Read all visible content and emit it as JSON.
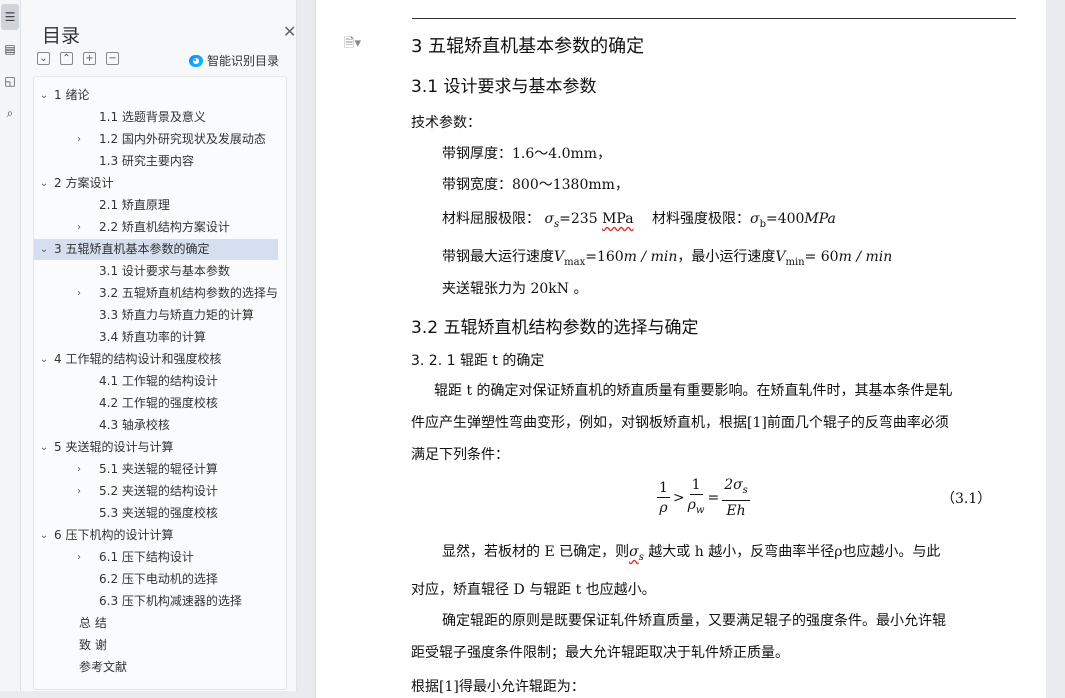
{
  "toc": {
    "title": "目录",
    "smart_recognize": "智能识别目录",
    "items": [
      {
        "label": "1  绪论",
        "level": 0,
        "arrow": "v"
      },
      {
        "label": "1.1  选题背景及意义",
        "level": 2,
        "arrow": ""
      },
      {
        "label": "1.2  国内外研究现状及发展动态",
        "level": 2,
        "arrow": ">"
      },
      {
        "label": "1.3  研究主要内容",
        "level": 2,
        "arrow": ""
      },
      {
        "label": "2  方案设计",
        "level": 0,
        "arrow": "v"
      },
      {
        "label": "2.1  矫直原理",
        "level": 2,
        "arrow": ""
      },
      {
        "label": "2.2  矫直机结构方案设计",
        "level": 2,
        "arrow": ">"
      },
      {
        "label": "3  五辊矫直机基本参数的确定",
        "level": 0,
        "arrow": "v",
        "selected": true
      },
      {
        "label": "3.1  设计要求与基本参数",
        "level": 2,
        "arrow": ""
      },
      {
        "label": "3.2  五辊矫直机结构参数的选择与…",
        "level": 2,
        "arrow": ">"
      },
      {
        "label": "3.3 矫直力与矫直力矩的计算",
        "level": 2,
        "arrow": ""
      },
      {
        "label": "3.4  矫直功率的计算",
        "level": 2,
        "arrow": ""
      },
      {
        "label": "4  工作辊的结构设计和强度校核",
        "level": 0,
        "arrow": "v"
      },
      {
        "label": "4.1 工作辊的结构设计",
        "level": 2,
        "arrow": ""
      },
      {
        "label": "4.2 工作辊的强度校核",
        "level": 2,
        "arrow": ""
      },
      {
        "label": "4.3 轴承校核",
        "level": 2,
        "arrow": ""
      },
      {
        "label": "5  夹送辊的设计与计算",
        "level": 0,
        "arrow": "v"
      },
      {
        "label": "5.1  夹送辊的辊径计算",
        "level": 2,
        "arrow": ">"
      },
      {
        "label": "5.2  夹送辊的结构设计",
        "level": 2,
        "arrow": ">"
      },
      {
        "label": "5.3  夹送辊的强度校核",
        "level": 2,
        "arrow": ""
      },
      {
        "label": "6  压下机构的设计计算",
        "level": 0,
        "arrow": "v"
      },
      {
        "label": "6.1 压下结构设计",
        "level": 2,
        "arrow": ">"
      },
      {
        "label": "6.2 压下电动机的选择",
        "level": 2,
        "arrow": ""
      },
      {
        "label": "6.3 压下机构减速器的选择",
        "level": 2,
        "arrow": ""
      },
      {
        "label": "总    结",
        "level": 1,
        "arrow": ""
      },
      {
        "label": "致    谢",
        "level": 1,
        "arrow": ""
      },
      {
        "label": "参考文献",
        "level": 1,
        "arrow": ""
      }
    ]
  },
  "doc": {
    "h1": "3  五辊矫直机基本参数的确定",
    "h2_1": "3.1  设计要求与基本参数",
    "tech_params": "技术参数：",
    "thickness": "带钢厚度：1.6～4.0mm，",
    "width": "带钢宽度：800～1380mm，",
    "yield_label": "材料屈服极限：",
    "yield_sym": "σ",
    "yield_sub": "s",
    "yield_val": "=235",
    "yield_unit": "MPa",
    "strength_label": "材料强度极限：",
    "strength_sym": "σ",
    "strength_sub": "b",
    "strength_val": "=400",
    "strength_unit": "MPa",
    "vmax_label": "带钢最大运行速度",
    "vmax_sym": "V",
    "vmax_sub": "max",
    "vmax_val": "=160",
    "vmax_unit": "m / min",
    "vmin_label": "，最小运行速度",
    "vmin_sym": "V",
    "vmin_sub": "min",
    "vmin_val": "= 60",
    "vmin_unit": "m / min",
    "tension": "夹送辊张力为 20kN  。",
    "h2_2": "3.2  五辊矫直机结构参数的选择与确定",
    "h3": "3. 2. 1  辊距 t 的确定",
    "p1": "辊距 t 的确定对保证矫直机的矫直质量有重要影响。在矫直轧件时，其基本条件是轧",
    "p2": "件应产生弹塑性弯曲变形，例如，对钢板矫直机，根据[1]前面几个辊子的反弯曲率必须",
    "p3": "满足下列条件：",
    "eq_one": "1",
    "eq_rho": "ρ",
    "eq_gt": ">",
    "eq_rhow": "ρ",
    "eq_w": "w",
    "eq_eq": "=",
    "eq_2sigma": "2σ",
    "eq_s": "s",
    "eq_Eh": "Eh",
    "eq_no": "（3.1）",
    "p4_a": "显然，若板材的 E 已确定，则",
    "p4_sigma": "σ",
    "p4_s": "s",
    "p4_b": " 越大或 h 越小，反弯曲率半径ρ也应越小。与此",
    "p5": "对应，矫直辊径 D 与辊距 t 也应越小。",
    "p6": "确定辊距的原则是既要保证轧件矫直质量，又要满足辊子的强度条件。最小允许辊",
    "p7": "距受辊子强度条件限制；最大允许辊距取决于轧件矫正质量。",
    "p8": "根据[1]得最小允许辊距为："
  }
}
